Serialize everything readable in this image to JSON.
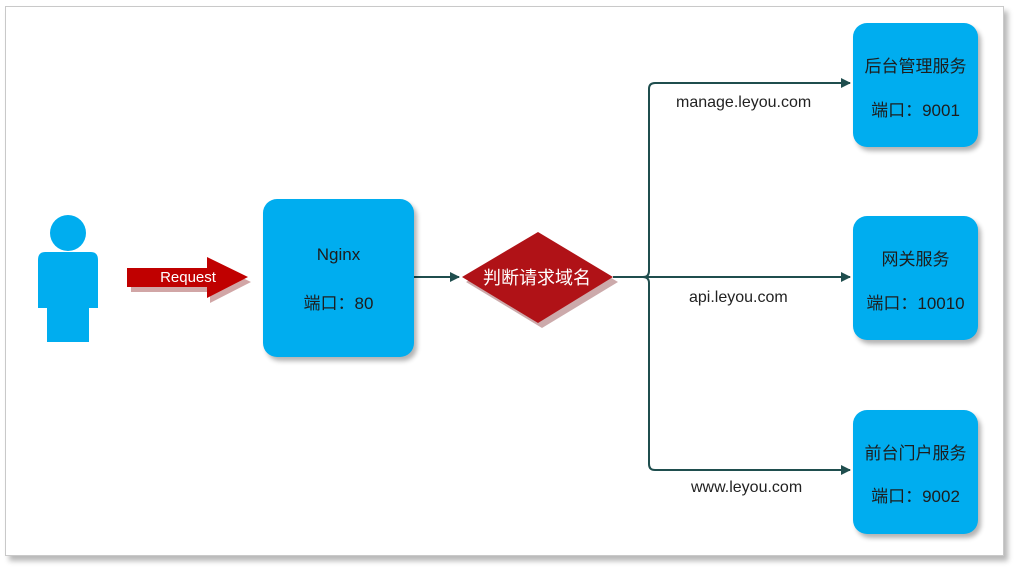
{
  "request_arrow": {
    "label": "Request",
    "color": "#c00000"
  },
  "nginx": {
    "title": "Nginx",
    "port": "端口：80"
  },
  "decision": {
    "label": "判断请求域名",
    "color": "#b01217"
  },
  "routes": [
    {
      "domain": "manage.leyou.com",
      "service": "后台管理服务",
      "port": "端口：9001"
    },
    {
      "domain": "api.leyou.com",
      "service": "网关服务",
      "port": "端口：10010"
    },
    {
      "domain": "www.leyou.com",
      "service": "前台门户服务",
      "port": "端口：9002"
    }
  ],
  "colors": {
    "box": "#00adef",
    "connector": "#1f4e4e",
    "user": "#00adef"
  },
  "icons": {
    "user": "person-icon"
  }
}
